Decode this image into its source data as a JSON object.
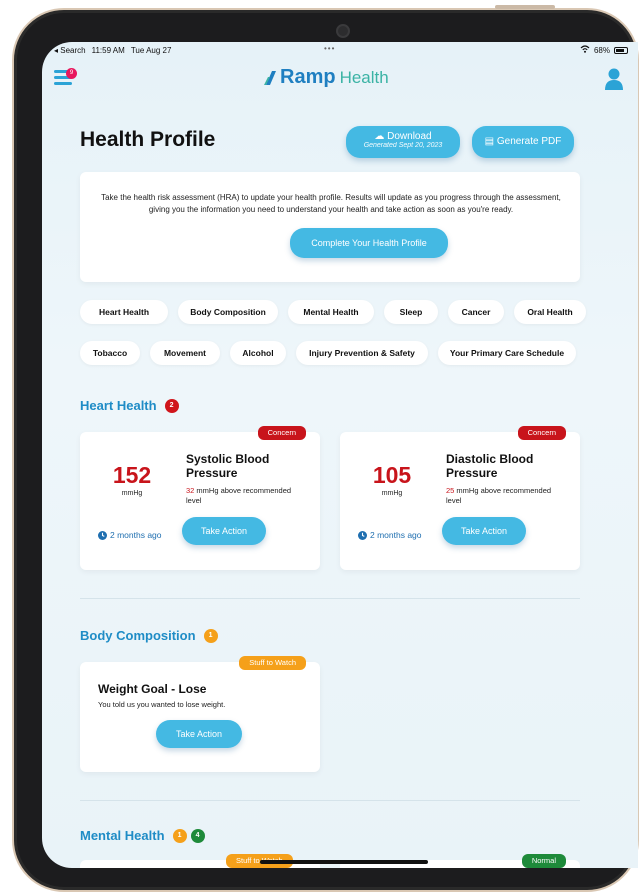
{
  "status_bar": {
    "back_label": "◂ Search",
    "time": "11:59 AM",
    "date": "Tue Aug 27",
    "dots": "•••",
    "battery": "68%"
  },
  "header": {
    "menu_badge": "9",
    "logo_ramp": "Ramp",
    "logo_health": "Health"
  },
  "page": {
    "title": "Health Profile",
    "download_label": "Download",
    "download_sub": "Generated Sept 20, 2023",
    "pdf_label": "Generate PDF"
  },
  "intro": {
    "text": "Take the health risk assessment (HRA) to update your health profile. Results will update as you progress through the assessment, giving you the information you need to understand your health and take action as soon as you're ready.",
    "button": "Complete Your Health Profile"
  },
  "chips": [
    "Heart Health",
    "Body Composition",
    "Mental Health",
    "Sleep",
    "Cancer",
    "Oral Health",
    "Tobacco",
    "Movement",
    "Alcohol",
    "Injury Prevention & Safety",
    "Your Primary Care Schedule"
  ],
  "heart": {
    "title": "Heart Health",
    "count": "2",
    "cards": [
      {
        "tag": "Concern",
        "value": "152",
        "unit": "mmHg",
        "name": "Systolic Blood Pressure",
        "note_num": "32",
        "note": " mmHg above recommended level",
        "time": "2 months ago",
        "action": "Take Action"
      },
      {
        "tag": "Concern",
        "value": "105",
        "unit": "mmHg",
        "name": "Diastolic Blood Pressure",
        "note_num": "25",
        "note": " mmHg above recommended level",
        "time": "2 months ago",
        "action": "Take Action"
      }
    ]
  },
  "body": {
    "title": "Body Composition",
    "count": "1",
    "card": {
      "tag": "Stuff to Watch",
      "name": "Weight Goal - Lose",
      "desc": "You told us you wanted to lose weight.",
      "action": "Take Action"
    }
  },
  "mental": {
    "title": "Mental Health",
    "count_orange": "1",
    "count_green": "4",
    "tag_left": "Stuff to Watch",
    "tag_right": "Normal"
  },
  "colors": {
    "accent": "#44b9e3",
    "title_blue": "#1f8cc6",
    "concern": "#c8141b",
    "watch": "#f5a01a",
    "normal": "#1e8a3a"
  }
}
